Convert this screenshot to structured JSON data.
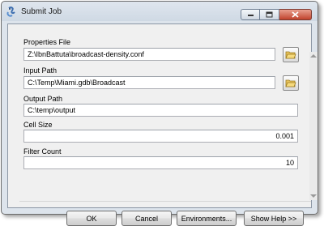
{
  "window": {
    "title": "Submit Job",
    "icon": "python-script-icon"
  },
  "fields": [
    {
      "label": "Properties File",
      "value": "Z:\\IbnBattuta\\broadcast-density.conf",
      "has_browse": true
    },
    {
      "label": "Input Path",
      "value": "C:\\Temp\\Miami.gdb\\Broadcast",
      "has_browse": true
    },
    {
      "label": "Output Path",
      "value": "C:\\temp\\output",
      "has_browse": false
    },
    {
      "label": "Cell Size",
      "value": "0.001",
      "has_browse": false
    },
    {
      "label": "Filter Count",
      "value": "10",
      "has_browse": false
    }
  ],
  "buttons": {
    "ok": "OK",
    "cancel": "Cancel",
    "environments": "Environments...",
    "show_help": "Show Help >>"
  },
  "colors": {
    "accent": "#4c8ed1",
    "close": "#c0432d"
  }
}
